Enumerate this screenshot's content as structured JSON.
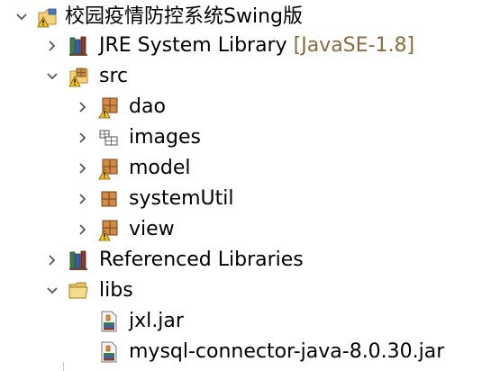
{
  "tree": {
    "project": {
      "label": "校园疫情防控系统Swing版",
      "icon": "java-project-warning-icon",
      "expanded": true
    },
    "jre": {
      "label": "JRE System Library",
      "suffix": "[JavaSE-1.8]",
      "icon": "library-icon"
    },
    "src": {
      "label": "src",
      "icon": "source-folder-warning-icon",
      "expanded": true,
      "packages": [
        {
          "label": "dao",
          "icon": "package-warning-icon"
        },
        {
          "label": "images",
          "icon": "package-empty-icon"
        },
        {
          "label": "model",
          "icon": "package-warning-icon"
        },
        {
          "label": "systemUtil",
          "icon": "package-icon"
        },
        {
          "label": "view",
          "icon": "package-warning-icon"
        }
      ]
    },
    "referenced": {
      "label": "Referenced Libraries",
      "icon": "library-icon"
    },
    "libs": {
      "label": "libs",
      "icon": "folder-open-icon",
      "expanded": true,
      "files": [
        {
          "label": "jxl.jar",
          "icon": "jar-file-icon"
        },
        {
          "label": "mysql-connector-java-8.0.30.jar",
          "icon": "jar-file-icon"
        }
      ]
    }
  },
  "colors": {
    "chevron": "#555555",
    "suffix": "#8a6b3e",
    "package": "#8b4513",
    "warning": "#f5c518"
  }
}
